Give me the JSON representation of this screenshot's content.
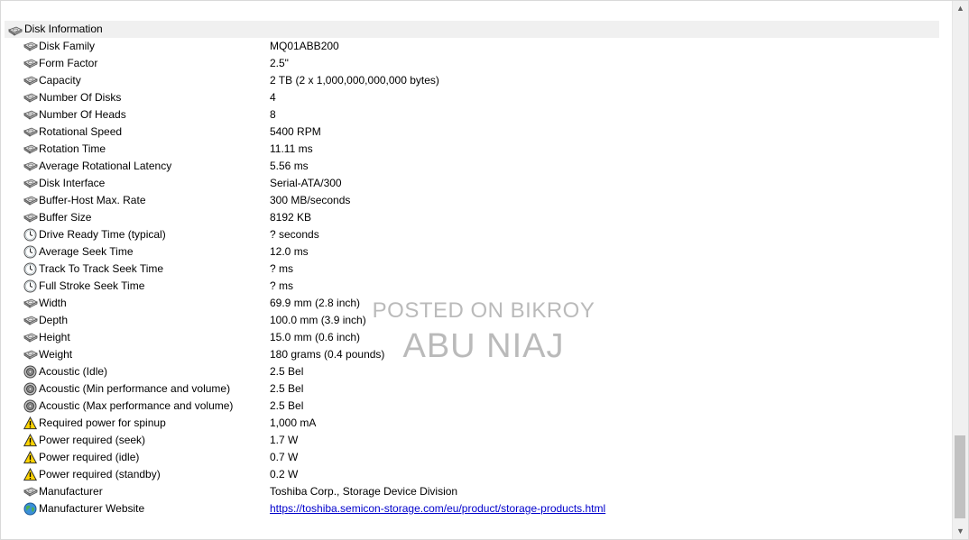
{
  "section": {
    "title": "Disk Information",
    "icon": "disk-icon"
  },
  "rows": [
    {
      "field": "Disk Family",
      "value": "MQ01ABB200",
      "icon": "disk-icon"
    },
    {
      "field": "Form Factor",
      "value": "2.5\"",
      "icon": "disk-icon"
    },
    {
      "field": "Capacity",
      "value": "2 TB (2 x 1,000,000,000,000 bytes)",
      "icon": "disk-icon"
    },
    {
      "field": "Number Of Disks",
      "value": "4",
      "icon": "disk-icon"
    },
    {
      "field": "Number Of Heads",
      "value": "8",
      "icon": "disk-icon"
    },
    {
      "field": "Rotational Speed",
      "value": "5400 RPM",
      "icon": "disk-icon"
    },
    {
      "field": "Rotation Time",
      "value": "11.11 ms",
      "icon": "disk-icon"
    },
    {
      "field": "Average Rotational Latency",
      "value": "5.56 ms",
      "icon": "disk-icon"
    },
    {
      "field": "Disk Interface",
      "value": "Serial-ATA/300",
      "icon": "disk-icon"
    },
    {
      "field": "Buffer-Host Max. Rate",
      "value": "300 MB/seconds",
      "icon": "disk-icon"
    },
    {
      "field": "Buffer Size",
      "value": "8192 KB",
      "icon": "disk-icon"
    },
    {
      "field": "Drive Ready Time (typical)",
      "value": "? seconds",
      "icon": "clock-icon"
    },
    {
      "field": "Average Seek Time",
      "value": "12.0 ms",
      "icon": "clock-icon"
    },
    {
      "field": "Track To Track Seek Time",
      "value": "? ms",
      "icon": "clock-icon"
    },
    {
      "field": "Full Stroke Seek Time",
      "value": "? ms",
      "icon": "clock-icon"
    },
    {
      "field": "Width",
      "value": "69.9 mm (2.8 inch)",
      "icon": "disk-icon"
    },
    {
      "field": "Depth",
      "value": "100.0 mm (3.9 inch)",
      "icon": "disk-icon"
    },
    {
      "field": "Height",
      "value": "15.0 mm (0.6 inch)",
      "icon": "disk-icon"
    },
    {
      "field": "Weight",
      "value": "180 grams (0.4 pounds)",
      "icon": "disk-icon"
    },
    {
      "field": "Acoustic (Idle)",
      "value": "2.5 Bel",
      "icon": "speaker-icon"
    },
    {
      "field": "Acoustic (Min performance and volume)",
      "value": "2.5 Bel",
      "icon": "speaker-icon"
    },
    {
      "field": "Acoustic (Max performance and volume)",
      "value": "2.5 Bel",
      "icon": "speaker-icon"
    },
    {
      "field": "Required power for spinup",
      "value": "1,000 mA",
      "icon": "warning-icon"
    },
    {
      "field": "Power required (seek)",
      "value": "1.7 W",
      "icon": "warning-icon"
    },
    {
      "field": "Power required (idle)",
      "value": "0.7 W",
      "icon": "warning-icon"
    },
    {
      "field": "Power required (standby)",
      "value": "0.2 W",
      "icon": "warning-icon"
    },
    {
      "field": "Manufacturer",
      "value": "Toshiba Corp., Storage Device Division",
      "icon": "disk-icon"
    },
    {
      "field": "Manufacturer Website",
      "value": "https://toshiba.semicon-storage.com/eu/product/storage-products.html",
      "icon": "globe-icon",
      "link": true
    }
  ],
  "watermark": {
    "line1": "POSTED ON BIKROY",
    "line2": "ABU NIAJ"
  },
  "scrollbar": {
    "up": "▲",
    "down": "▼"
  }
}
